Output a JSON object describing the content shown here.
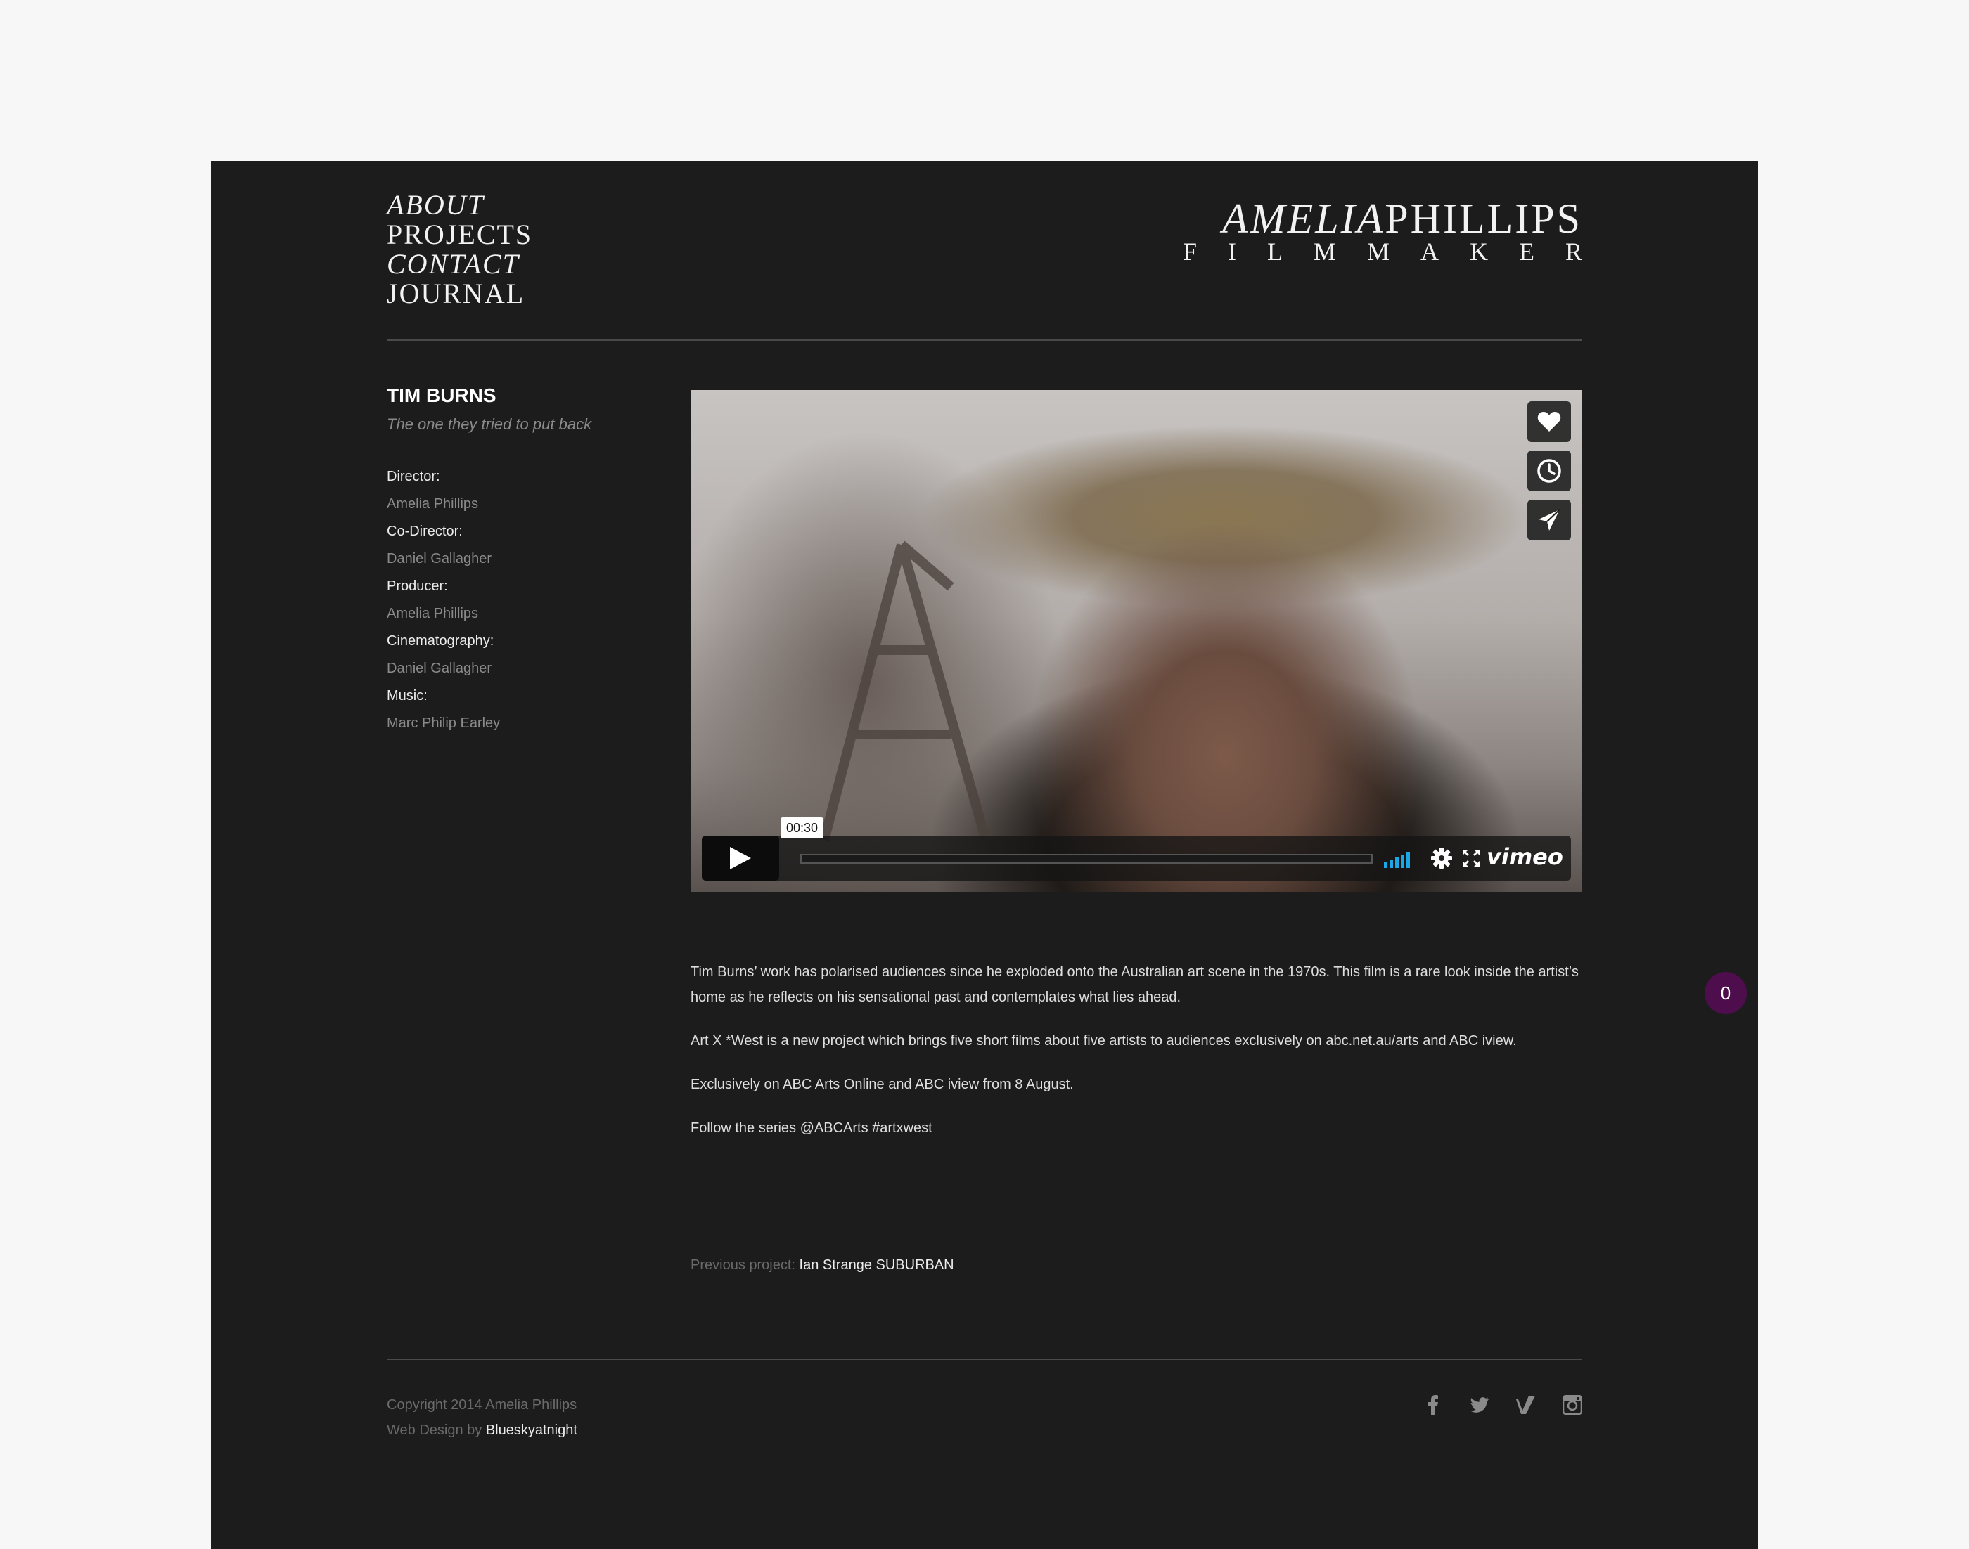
{
  "nav": {
    "items": [
      {
        "label": "ABOUT"
      },
      {
        "label": "PROJECTS"
      },
      {
        "label": "CONTACT"
      },
      {
        "label": "JOURNAL"
      }
    ]
  },
  "logo": {
    "first_name": "AMELIA",
    "last_name": "PHILLIPS",
    "subtitle": "FILMMAKER"
  },
  "project": {
    "title": "TIM BURNS",
    "tagline": "The one they tried to put back",
    "credits": [
      {
        "label": "Director:",
        "value": "Amelia Phillips"
      },
      {
        "label": "Co-Director:",
        "value": "Daniel Gallagher"
      },
      {
        "label": "Producer:",
        "value": "Amelia Phillips"
      },
      {
        "label": "Cinematography:",
        "value": "Daniel Gallagher"
      },
      {
        "label": "Music:",
        "value": "Marc Philip Earley"
      }
    ]
  },
  "video": {
    "timecode": "00:30",
    "brand": "vimeo",
    "progress": 0.0,
    "side_buttons": [
      "heart-icon",
      "clock-icon",
      "paper-plane-icon"
    ]
  },
  "description": {
    "paragraphs": [
      "Tim Burns’ work has polarised audiences since he exploded onto the Australian art scene in the 1970s. This film is a rare look inside the artist’s home as he reflects on his sensational past and contemplates what lies ahead.",
      "Art X *West is a new project which brings five short films about five artists to audiences exclusively on abc.net.au/arts and ABC iview.",
      "Exclusively on ABC Arts Online and ABC iview from 8 August.",
      "Follow the series @ABCArts #artxwest"
    ]
  },
  "previous_project": {
    "label": "Previous project:",
    "title": "Ian Strange SUBURBAN"
  },
  "footer": {
    "copyright": "Copyright 2014 Amelia Phillips",
    "credit_prefix": "Web Design by",
    "credit_link": "Blueskyatnight",
    "social": [
      "facebook-icon",
      "twitter-icon",
      "vimeo-icon",
      "instagram-icon"
    ]
  },
  "badge": {
    "count": "0"
  },
  "colors": {
    "page_bg": "#f7f7f7",
    "site_bg": "#1c1c1c",
    "accent_volume": "#1aa8e6",
    "badge_bg": "#4e0d4d"
  }
}
